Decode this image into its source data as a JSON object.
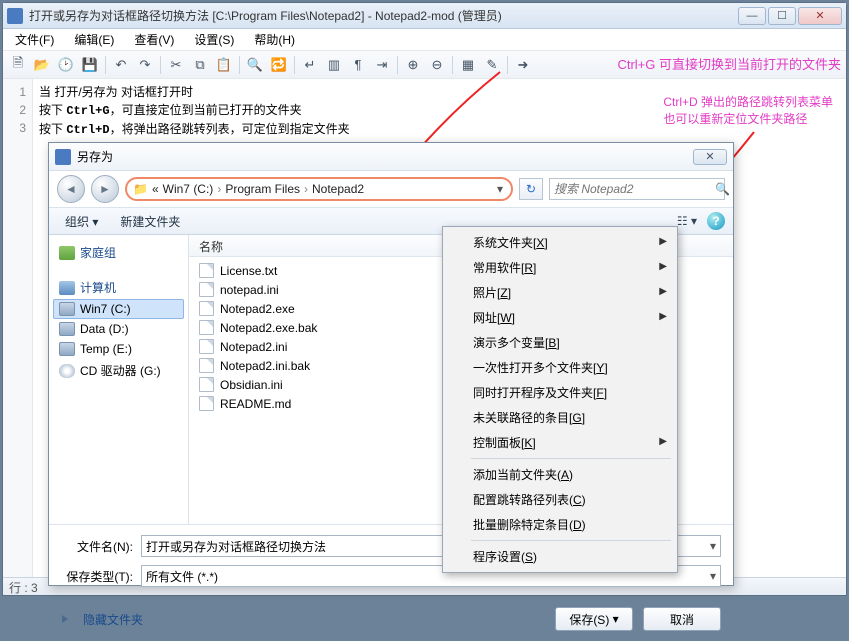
{
  "window": {
    "title": "打开或另存为对话框路径切换方法 [C:\\Program Files\\Notepad2] - Notepad2-mod (管理员)"
  },
  "menus": [
    "文件(F)",
    "编辑(E)",
    "查看(V)",
    "设置(S)",
    "帮助(H)"
  ],
  "editor": {
    "lines": [
      "1",
      "2",
      "3"
    ],
    "l1": "当 打开/另存为 对话框打开时",
    "l2a": "按下 ",
    "l2b": "Ctrl+G",
    "l2c": "，可直接定位到当前已打开的文件夹",
    "l3a": "按下 ",
    "l3b": "Ctrl+D",
    "l3c": "，将弹出路径跳转列表，可定位到指定文件夹"
  },
  "status": "行 : 3",
  "annot": {
    "a1": "Ctrl+G 可直接切换到当前打开的文件夹",
    "a2a": "Ctrl+D 弹出的路径跳转列表菜单",
    "a2b": "也可以重新定位文件夹路径"
  },
  "dialog": {
    "title": "另存为",
    "bc_prefix": "«",
    "bc_parts": [
      "Win7 (C:)",
      "Program Files",
      "Notepad2"
    ],
    "search_placeholder": "搜索 Notepad2",
    "cmd_organize": "组织 ▾",
    "cmd_newfolder": "新建文件夹",
    "tree": {
      "home": "家庭组",
      "pc": "计算机",
      "c": "Win7 (C:)",
      "d": "Data (D:)",
      "e": "Temp (E:)",
      "g": "CD 驱动器 (G:)"
    },
    "col_name": "名称",
    "files": [
      "License.txt",
      "notepad.ini",
      "Notepad2.exe",
      "Notepad2.exe.bak",
      "Notepad2.ini",
      "Notepad2.ini.bak",
      "Obsidian.ini",
      "README.md"
    ],
    "label_filename": "文件名(N):",
    "label_filetype": "保存类型(T):",
    "filename_value": "打开或另存为对话框路径切换方法",
    "filetype_value": "所有文件 (*.*)",
    "hide": "隐藏文件夹",
    "save": "保存(S)",
    "cancel": "取消"
  },
  "ctx": [
    {
      "t": "系统文件夹[X]",
      "sub": true
    },
    {
      "t": "常用软件[R]",
      "sub": true
    },
    {
      "t": "照片[Z]",
      "sub": true
    },
    {
      "t": "网址[W]",
      "sub": true
    },
    {
      "t": "演示多个变量[B]",
      "sub": false
    },
    {
      "t": "一次性打开多个文件夹[Y]",
      "sub": false
    },
    {
      "t": "同时打开程序及文件夹[F]",
      "sub": false
    },
    {
      "t": "未关联路径的条目[G]",
      "sub": false
    },
    {
      "t": "控制面板[K]",
      "sub": true
    },
    "---",
    {
      "t": "添加当前文件夹(A)",
      "sub": false
    },
    {
      "t": "配置跳转路径列表(C)",
      "sub": false
    },
    {
      "t": "批量删除特定条目(D)",
      "sub": false
    },
    "---",
    {
      "t": "程序设置(S)",
      "sub": false
    }
  ]
}
